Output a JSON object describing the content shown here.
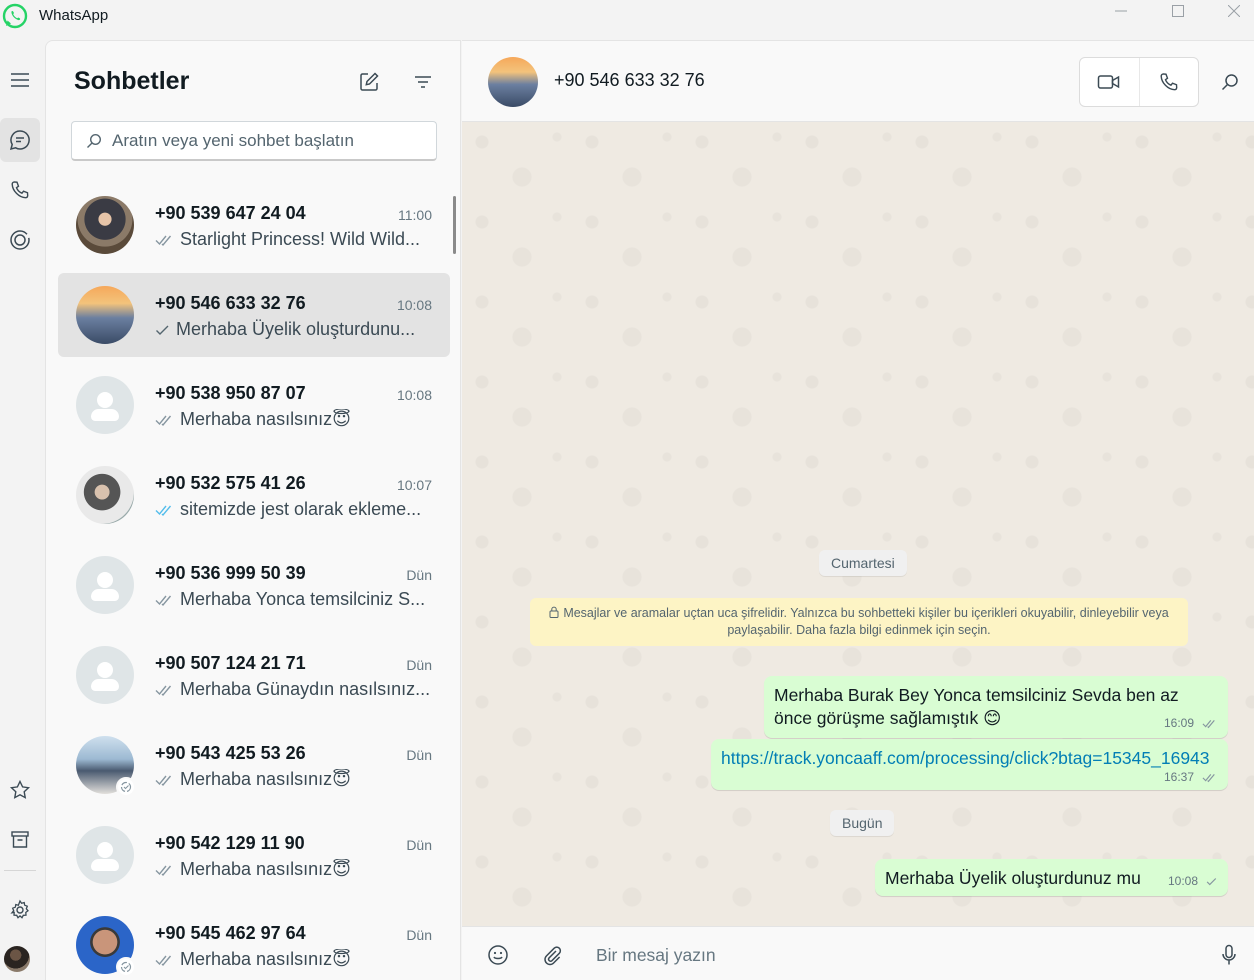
{
  "app": {
    "title": "WhatsApp"
  },
  "rail": {
    "items": [
      "menu-icon",
      "chats-icon",
      "calls-icon",
      "status-icon"
    ],
    "bottom": [
      "starred-icon",
      "archive-icon",
      "settings-icon",
      "profile-avatar"
    ]
  },
  "list": {
    "title": "Sohbetler",
    "search_placeholder": "Aratın veya yeni sohbet başlatın",
    "chats": [
      {
        "name": "+90 539 647 24 04",
        "time": "11:00",
        "preview": "Starlight Princess! Wild Wild...",
        "tick": "double-grey"
      },
      {
        "name": "+90 546 633 32 76",
        "time": "10:08",
        "preview": "Merhaba Üyelik oluşturdunu...",
        "tick": "single-grey"
      },
      {
        "name": "+90 538 950 87 07",
        "time": "10:08",
        "preview": "Merhaba nasılsınız😇",
        "tick": "double-grey"
      },
      {
        "name": "+90 532 575 41 26",
        "time": "10:07",
        "preview": "sitemizde jest olarak ekleme...",
        "tick": "double-blue"
      },
      {
        "name": "+90 536 999 50 39",
        "time": "Dün",
        "preview": "Merhaba Yonca temsilciniz S...",
        "tick": "double-grey"
      },
      {
        "name": "+90 507 124 21 71",
        "time": "Dün",
        "preview": "Merhaba Günaydın nasılsınız...",
        "tick": "double-grey"
      },
      {
        "name": "+90 543 425 53 26",
        "time": "Dün",
        "preview": "Merhaba nasılsınız😇",
        "tick": "double-grey"
      },
      {
        "name": "+90 542 129 11 90",
        "time": "Dün",
        "preview": "Merhaba nasılsınız😇",
        "tick": "double-grey"
      },
      {
        "name": "+90 545 462 97 64",
        "time": "Dün",
        "preview": "Merhaba nasılsınız😇",
        "tick": "double-grey"
      }
    ]
  },
  "conversation": {
    "contact_name": "+90 546 633 32 76",
    "day1": "Cumartesi",
    "encryption_note": "Mesajlar ve aramalar uçtan uca şifrelidir. Yalnızca bu sohbetteki kişiler bu içerikleri okuyabilir, dinleyebilir veya paylaşabilir. Daha fazla bilgi edinmek için seçin.",
    "day2": "Bugün",
    "messages": [
      {
        "text": "Merhaba Burak Bey Yonca temsilciniz Sevda ben az önce görüşme sağlamıştık 😊",
        "time": "16:09"
      },
      {
        "text": "https://track.yoncaaff.com/processing/click?btag=15345_16943",
        "time": "16:37"
      },
      {
        "text": "Merhaba Üyelik oluşturdunuz mu",
        "time": "10:08"
      }
    ],
    "composer_placeholder": "Bir mesaj yazın"
  },
  "colors": {
    "bubble_out": "#d9fdd3",
    "accent": "#25d366",
    "read_tick": "#53bdeb",
    "link": "#027eb5"
  }
}
